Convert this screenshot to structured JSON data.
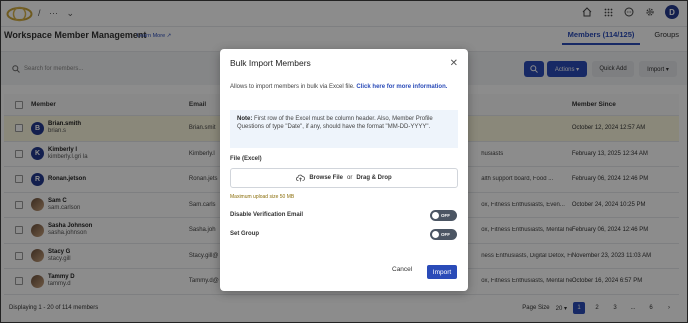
{
  "breadcrumb": {
    "sep": "/",
    "more": "···",
    "chevron": "⌄"
  },
  "topbar": {
    "user_initial": "D"
  },
  "page": {
    "title": "Workspace Member Management",
    "learn_more": "Learn More"
  },
  "tabs": [
    {
      "label": "Members (114/125)",
      "active": true
    },
    {
      "label": "Groups",
      "active": false
    }
  ],
  "toolbar": {
    "search_placeholder": "Search for members...",
    "actions_label": "Actions ▾",
    "quick_add_label": "Quick Add",
    "import_label": "Import ▾"
  },
  "table": {
    "headers": {
      "member": "Member",
      "email": "Email",
      "member_since": "Member Since"
    },
    "rows": [
      {
        "initial": "B",
        "name": "Brian.smith",
        "username": "brian.s",
        "email": "Brian.smit",
        "tags": "",
        "since": "October 12, 2024 12:57 AM",
        "photo": false,
        "highlight": true
      },
      {
        "initial": "K",
        "name": "Kimberly l",
        "username": "kimberly.l.gri la",
        "email": "Kimberly.l",
        "tags": "husiasts",
        "since": "February 13, 2025 12:34 AM",
        "photo": false,
        "highlight": false
      },
      {
        "initial": "R",
        "name": "Ronan.jetson",
        "username": "",
        "email": "Ronan.jets",
        "tags": "alth support board, Food ...",
        "since": "February 06, 2024 12:46 PM",
        "photo": false,
        "highlight": false
      },
      {
        "initial": "",
        "name": "Sam C",
        "username": "sam.carlson",
        "email": "Sam.carls",
        "tags": "ox, Fitness Enthusiasts, Even...",
        "since": "October 24, 2024 10:25 PM",
        "photo": true,
        "highlight": false
      },
      {
        "initial": "",
        "name": "Sasha Johnson",
        "username": "sasha.johnson",
        "email": "Sasha.joh",
        "tags": "ox, Fitness Enthusiasts, Mental health ...",
        "since": "February 06, 2024 12:46 PM",
        "photo": true,
        "highlight": false
      },
      {
        "initial": "",
        "name": "Stacy G",
        "username": "stacy.gill",
        "email": "Stacy.gill@",
        "tags": "ness Enthusiasts, Digital Detox, Fi...",
        "since": "November 23, 2023 11:03 AM",
        "photo": true,
        "highlight": false
      },
      {
        "initial": "",
        "name": "Tammy D",
        "username": "tammy.d",
        "email": "Tammy.d@",
        "tags": "ox, Fitness Enthusiasts, Mental health ...",
        "since": "October 16, 2024 6:57 PM",
        "photo": true,
        "highlight": false
      }
    ]
  },
  "footer": {
    "displaying": "Displaying 1 - 20 of 114 members",
    "page_size_label": "Page Size",
    "page_size_value": "20",
    "pages": [
      "1",
      "2",
      "3",
      "...",
      "6"
    ]
  },
  "modal": {
    "title": "Bulk Import Members",
    "intro": "Allows to import members in bulk via Excel file.",
    "intro_link": "Click here for more information.",
    "note_label": "Note:",
    "note_text": "First row of the Excel must be column header. Also, Member Profile Questions of type \"Date\", if any, should have the format \"MM-DD-YYYY\".",
    "file_label": "File (Excel)",
    "browse": "Browse File",
    "or": "or",
    "drag": "Drag & Drop",
    "upload_hint": "Maximum upload size 50 MB",
    "disable_email_label": "Disable Verification Email",
    "disable_email_state": "OFF",
    "set_group_label": "Set Group",
    "set_group_state": "OFF",
    "cancel": "Cancel",
    "import": "Import"
  },
  "colors": {
    "accent": "#2a4bb8",
    "highlight_row": "#fbf7de",
    "note_bg": "#eef4fb"
  }
}
